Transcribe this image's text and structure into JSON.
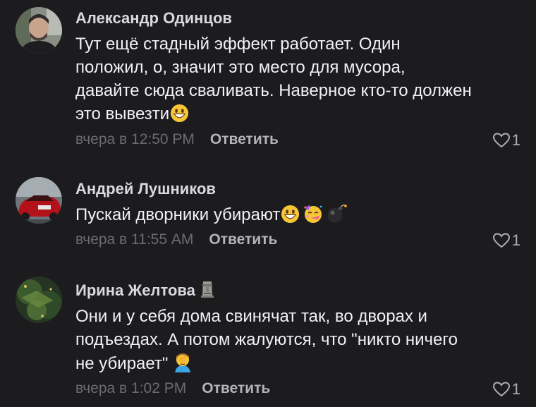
{
  "comments": [
    {
      "author": "Александр Одинцов",
      "text_lines": [
        "Тут ещё стадный эффект работает. Один",
        "положил, о, значит это место для мусора,",
        "давайте сюда сваливать. Наверное кто-то должен",
        "это вывезти"
      ],
      "emojis": [
        "grinning-face-emoji"
      ],
      "time": "вчера в 12:50 PM",
      "reply_label": "Ответить",
      "likes": "1"
    },
    {
      "author": "Андрей Лушников",
      "text_lines": [
        "Пускай дворники убирают"
      ],
      "emojis": [
        "grinning-face-emoji",
        "partying-face-emoji",
        "bomb-emoji"
      ],
      "time": "вчера в 11:55 AM",
      "reply_label": "Ответить",
      "likes": "1"
    },
    {
      "author": "Ирина Желтова",
      "author_badge": "moai-emoji",
      "text_lines": [
        "Они и у себя дома свинячат так,  во дворах и",
        "подъездах.  А потом жалуются,  что \"никто ничего",
        "не убирает\""
      ],
      "emojis": [
        "person-facepalming-emoji"
      ],
      "time": "вчера в 1:02 PM",
      "reply_label": "Ответить",
      "likes": "1"
    }
  ],
  "colors": {
    "background": "#1c1c1e",
    "author": "#d9d9de",
    "text": "#f2f2f4",
    "meta": "#6b6b72",
    "reply": "#b3b3b9"
  },
  "icons": {
    "like": "heart-outline-icon"
  }
}
